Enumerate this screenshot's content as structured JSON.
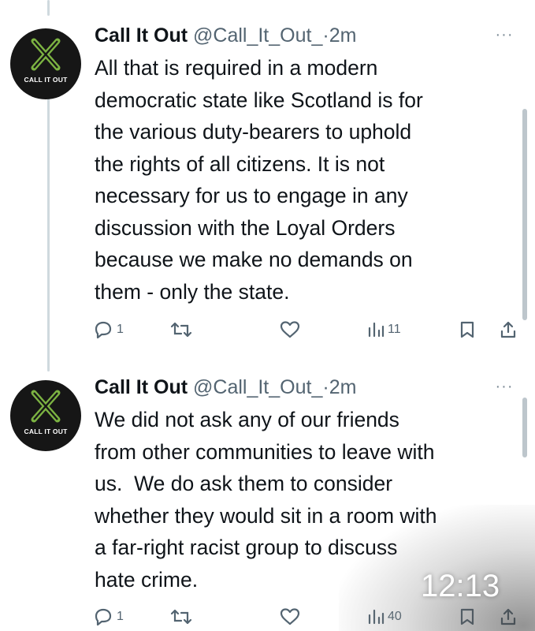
{
  "tweets": [
    {
      "avatar_text": "CALL IT OUT",
      "name": "Call It Out",
      "handle": "@Call_It_Out_",
      "separator": "·",
      "time": "2m",
      "more": "···",
      "text": "All that is required in a modern\ndemocratic state like Scotland is for\nthe various duty-bearers to uphold\nthe rights of all citizens. It is not\nnecessary for us to engage in any\ndiscussion with the Loyal Orders\nbecause we make no demands on\nthem - only the state.",
      "reply_count": "1",
      "retweet_count": "",
      "like_count": "",
      "view_count": "11"
    },
    {
      "avatar_text": "CALL IT OUT",
      "name": "Call It Out",
      "handle": "@Call_It_Out_",
      "separator": "·",
      "time": "2m",
      "more": "···",
      "text": "We did not ask any of our friends\nfrom other communities to leave with\nus.  We do ask them to consider\nwhether they would sit in a room with\na far-right racist group to discuss\nhate crime.",
      "reply_count": "1",
      "retweet_count": "",
      "like_count": "",
      "view_count": "40"
    }
  ],
  "overlay_time": "12:13",
  "colors": {
    "text": "#0f1419",
    "muted": "#536471",
    "logo_green": "#7cb342",
    "avatar_bg": "#161616"
  }
}
